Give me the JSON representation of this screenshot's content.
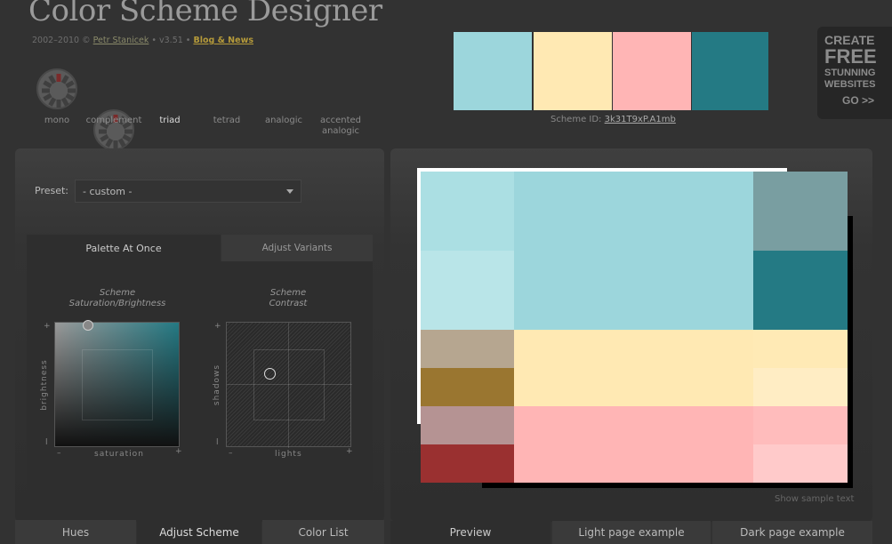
{
  "header": {
    "title": "Color Scheme Designer",
    "copyright": "2002–2010 ©",
    "author": "Petr Stanicek",
    "version": "• v3.51 •",
    "blog": "Blog & News"
  },
  "scheme_types": [
    {
      "label": "mono",
      "active": false
    },
    {
      "label": "complement",
      "active": false
    },
    {
      "label": "triad",
      "active": true
    },
    {
      "label": "tetrad",
      "active": false
    },
    {
      "label": "analogic",
      "active": false
    },
    {
      "label": "accented",
      "label2": "analogic",
      "active": false
    }
  ],
  "swatches": [
    "#9CD6DC",
    "#FFE9B3",
    "#FFB5B5",
    "#247A84"
  ],
  "scheme_id": {
    "label": "Scheme ID:",
    "value": "3k31T9xP.A1mb"
  },
  "ad": {
    "line1": "CREATE",
    "line2": "FREE",
    "line3": "STUNNING",
    "line4": "WEBSITES",
    "go": "GO >>"
  },
  "preset": {
    "label": "Preset:",
    "value": "- custom -"
  },
  "panel_tabs": {
    "palette": "Palette At Once",
    "variants": "Adjust Variants"
  },
  "plot1": {
    "title1": "Scheme",
    "title2": "Saturation/Brightness",
    "x": "saturation",
    "y": "brightness"
  },
  "plot2": {
    "title1": "Scheme",
    "title2": "Contrast",
    "x": "lights",
    "y": "shadows"
  },
  "plot_marks": {
    "minus": "–",
    "plus": "+",
    "top": "+",
    "bottom": "l"
  },
  "left_tabs": [
    "Hues",
    "Adjust Scheme",
    "Color List"
  ],
  "right_tabs": [
    "Preview",
    "Light page example",
    "Dark page example"
  ],
  "sample_text": "Show sample text",
  "preview": {
    "blue": [
      "#ABDFE3",
      "#B9E5E8",
      "#9CD6DC",
      "#799EA1",
      "#247A84"
    ],
    "yellow": [
      "#FFE9B3",
      "#FFEAB5",
      "#FFEDC4"
    ],
    "red": [
      "#FFB5B5",
      "#FFBCBC",
      "#FFCACA"
    ],
    "left_darks": [
      "#B6A690",
      "#9A7630",
      "#B59393",
      "#9A3030"
    ]
  }
}
